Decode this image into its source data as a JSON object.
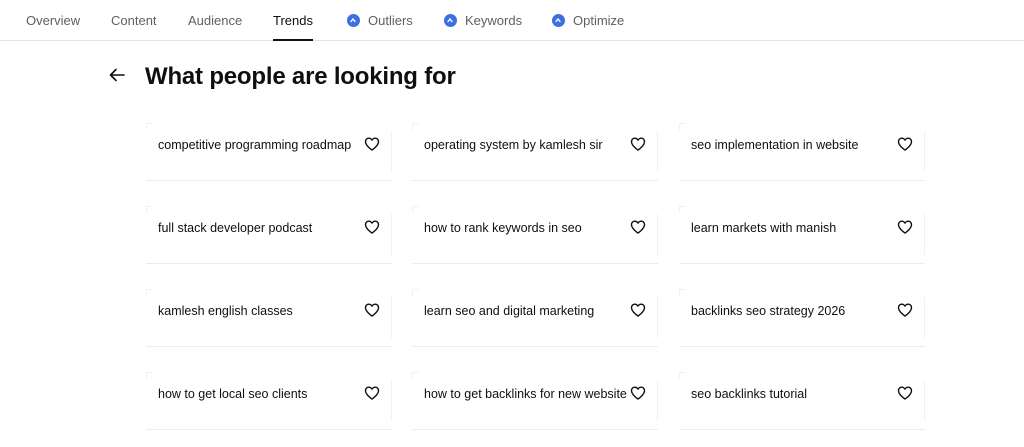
{
  "tabs": [
    {
      "label": "Overview",
      "icon": null
    },
    {
      "label": "Content",
      "icon": null
    },
    {
      "label": "Audience",
      "icon": null
    },
    {
      "label": "Trends",
      "icon": null,
      "active": true
    },
    {
      "label": "Outliers",
      "icon": "extension-badge-icon"
    },
    {
      "label": "Keywords",
      "icon": "extension-badge-icon"
    },
    {
      "label": "Optimize",
      "icon": "extension-badge-icon"
    }
  ],
  "page": {
    "title": "What people are looking for"
  },
  "cards": [
    "competitive programming roadmap",
    "operating system by kamlesh sir",
    "seo implementation in website",
    "full stack developer podcast",
    "how to rank keywords in seo",
    "learn markets with manish",
    "kamlesh english classes",
    "learn seo and digital marketing",
    "backlinks seo strategy 2026",
    "how to get local seo clients",
    "how to get backlinks for new website",
    "seo backlinks tutorial"
  ],
  "colors": {
    "badge": "#3d6fe0",
    "text": "#0f0f0f",
    "muted": "#606060"
  }
}
